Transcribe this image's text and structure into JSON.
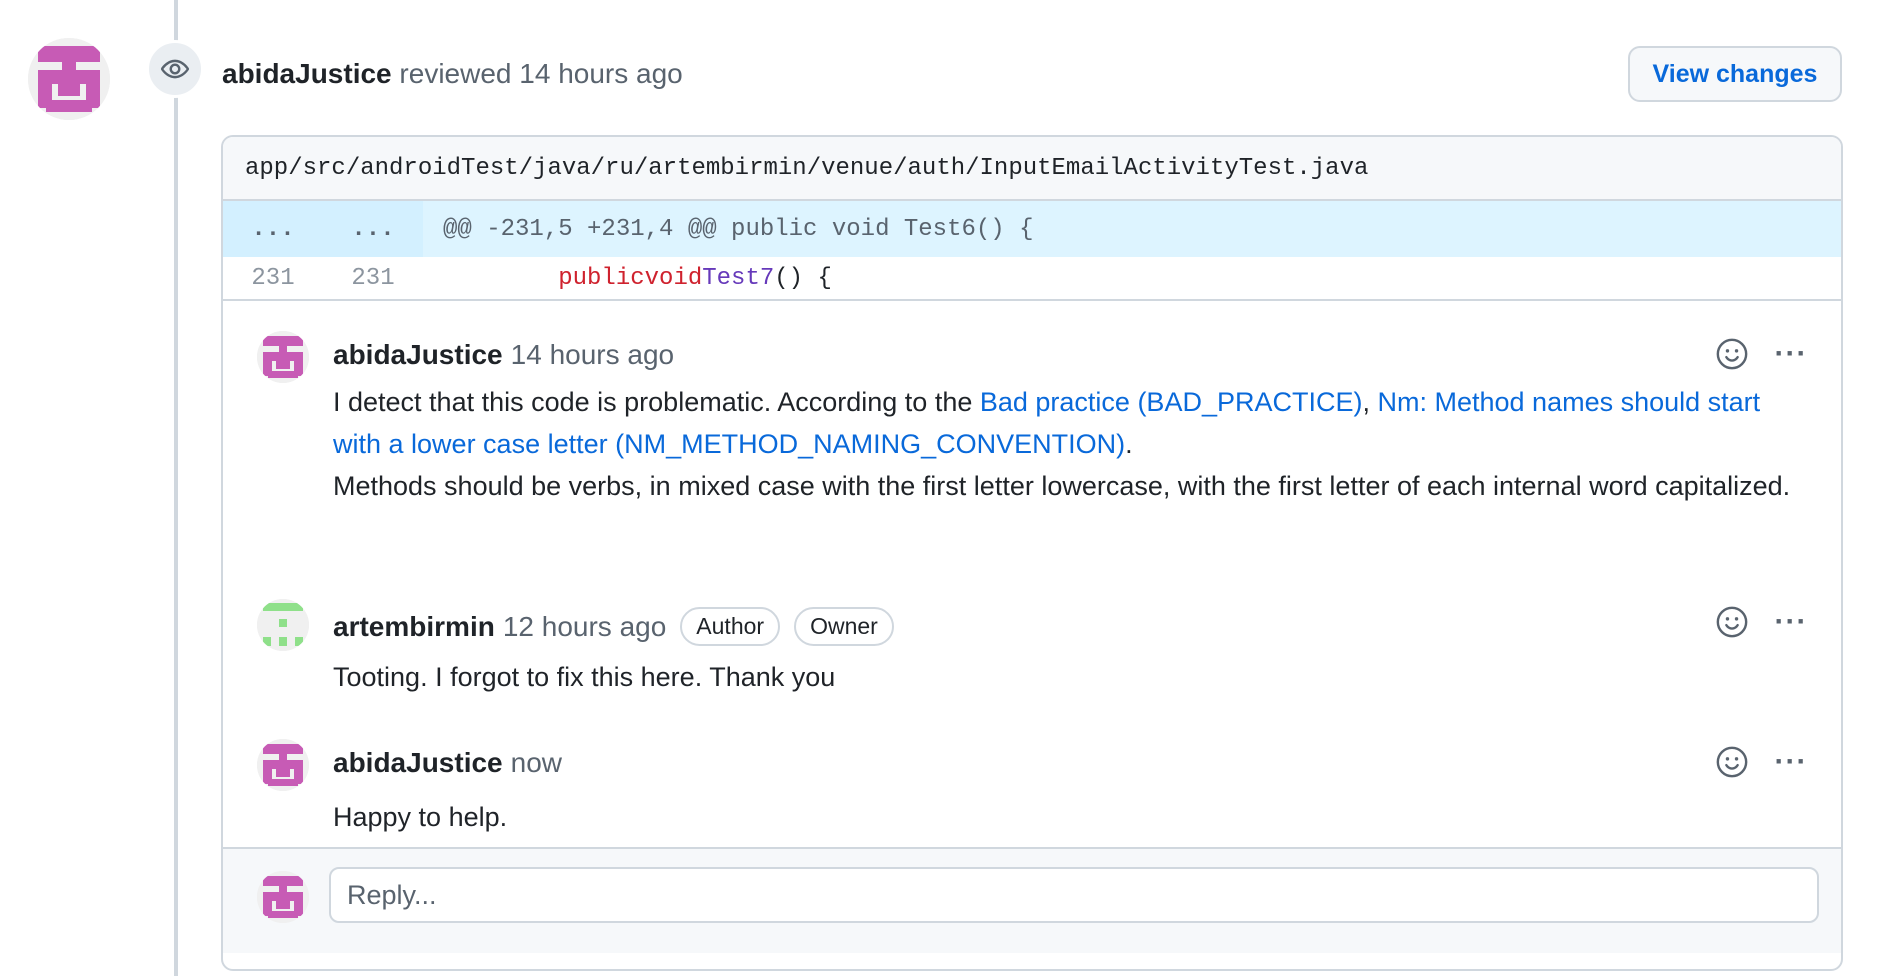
{
  "colors": {
    "link": "#0969da",
    "avatar_abida": "#c75bb5",
    "avatar_artem": "#8fe08a",
    "hunk_bg": "#ddf4ff",
    "keyword": "#cf222e",
    "function": "#6639ba"
  },
  "review": {
    "author": "abidaJustice",
    "action": "reviewed",
    "time": "14 hours ago",
    "icon": "eye-icon",
    "view_changes_label": "View changes"
  },
  "file": {
    "path": "app/src/androidTest/java/ru/artembirmin/venue/auth/InputEmailActivityTest.java",
    "hunk": {
      "left_num": "...",
      "right_num": "...",
      "header": "@@ -231,5 +231,4 @@ public void Test6() {"
    },
    "code_line": {
      "left_num": "231",
      "right_num": "231",
      "indent": "        ",
      "kw1": "public",
      "kw2": "void",
      "fn": "Test7",
      "rest": "() {"
    }
  },
  "comments": [
    {
      "author": "abidaJustice",
      "time": "14 hours ago",
      "text_pre": "I detect that this code is problematic. According to the ",
      "link1": "Bad practice (BAD_PRACTICE)",
      "sep": ", ",
      "link2": "Nm: Method names should start with a lower case letter (NM_METHOD_NAMING_CONVENTION)",
      "text_post": ".",
      "text_2": "Methods should be verbs, in mixed case with the first letter lowercase, with the first letter of each internal word capitalized."
    },
    {
      "author": "artembirmin",
      "time": "12 hours ago",
      "badges": [
        "Author",
        "Owner"
      ],
      "text": "Tooting. I forgot to fix this here. Thank you"
    },
    {
      "author": "abidaJustice",
      "time": "now",
      "text": "Happy to help."
    }
  ],
  "actions": {
    "more_label": "···",
    "emoji_icon": "smiley-icon"
  },
  "reply": {
    "placeholder": "Reply..."
  }
}
